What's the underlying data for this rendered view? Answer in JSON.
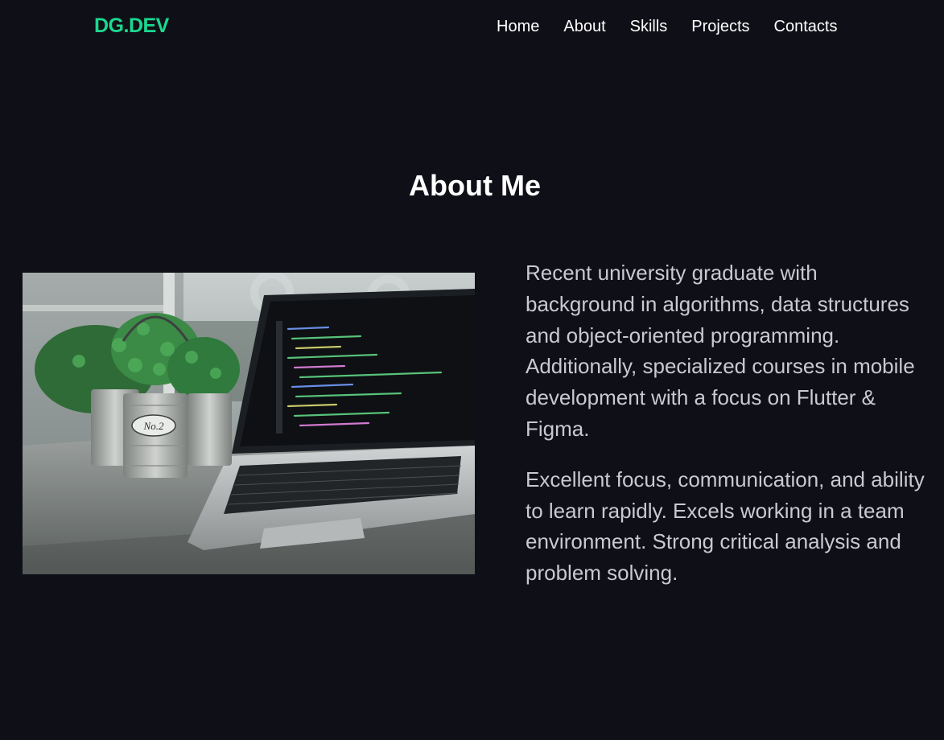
{
  "header": {
    "logo": "DG.DEV",
    "nav": [
      "Home",
      "About",
      "Skills",
      "Projects",
      "Contacts"
    ]
  },
  "about": {
    "title": "About Me",
    "paragraphs": [
      "Recent university graduate with background in algorithms, data structures and object-oriented programming. Additionally, specialized courses in mobile development with a focus on Flutter & Figma.",
      "Excellent focus, communication, and ability to learn rapidly. Excels working in a team environment. Strong critical analysis and problem solving."
    ],
    "image": {
      "pot_label": "No.2"
    }
  },
  "colors": {
    "background": "#0f0f17",
    "accent": "#19d98f",
    "heading": "#ffffff",
    "body_text": "#c9c9d1"
  }
}
